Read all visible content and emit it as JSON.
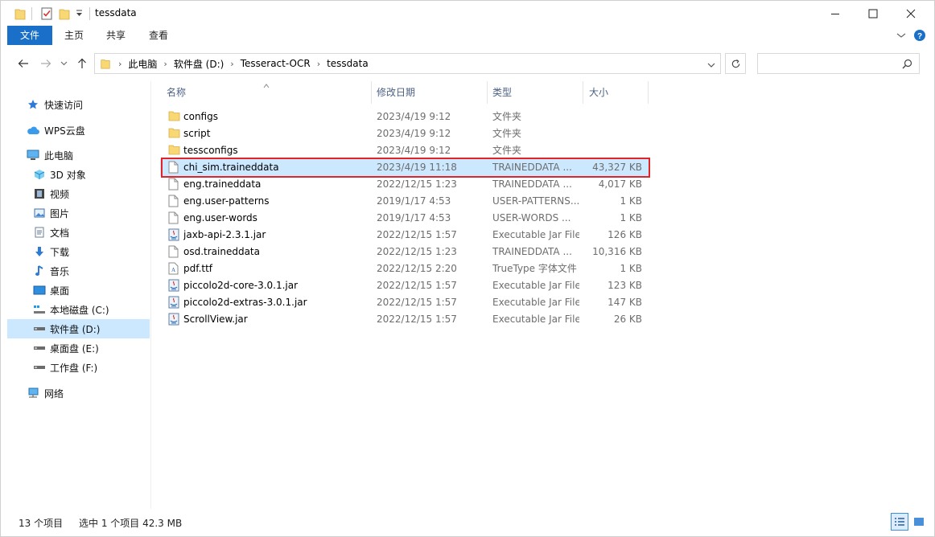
{
  "window": {
    "title": "tessdata",
    "buttons": {
      "minimize": "—",
      "maximize": "☐",
      "close": "✕"
    }
  },
  "ribbon": {
    "tabs": [
      {
        "label": "文件"
      },
      {
        "label": "主页"
      },
      {
        "label": "共享"
      },
      {
        "label": "查看"
      }
    ]
  },
  "address": {
    "crumbs": [
      "此电脑",
      "软件盘 (D:)",
      "Tesseract-OCR",
      "tessdata"
    ],
    "search_placeholder": ""
  },
  "sidebar": {
    "items": [
      {
        "label": "快速访问",
        "icon": "star-icon"
      },
      {
        "label": "WPS云盘",
        "icon": "cloud-icon"
      },
      {
        "label": "此电脑",
        "icon": "computer-icon"
      },
      {
        "label": "3D 对象",
        "icon": "cube-icon"
      },
      {
        "label": "视频",
        "icon": "video-icon"
      },
      {
        "label": "图片",
        "icon": "picture-icon"
      },
      {
        "label": "文档",
        "icon": "document-icon"
      },
      {
        "label": "下载",
        "icon": "download-icon"
      },
      {
        "label": "音乐",
        "icon": "music-icon"
      },
      {
        "label": "桌面",
        "icon": "desktop-icon"
      },
      {
        "label": "本地磁盘 (C:)",
        "icon": "system-drive-icon"
      },
      {
        "label": "软件盘 (D:)",
        "icon": "drive-icon",
        "selected": true
      },
      {
        "label": "桌面盘 (E:)",
        "icon": "drive-icon"
      },
      {
        "label": "工作盘 (F:)",
        "icon": "drive-icon"
      },
      {
        "label": "网络",
        "icon": "network-icon"
      }
    ]
  },
  "columns": {
    "name": "名称",
    "date": "修改日期",
    "type": "类型",
    "size": "大小"
  },
  "files": [
    {
      "name": "configs",
      "date": "2023/4/19 9:12",
      "type": "文件夹",
      "size": "",
      "icon": "folder-icon"
    },
    {
      "name": "script",
      "date": "2023/4/19 9:12",
      "type": "文件夹",
      "size": "",
      "icon": "folder-icon"
    },
    {
      "name": "tessconfigs",
      "date": "2023/4/19 9:12",
      "type": "文件夹",
      "size": "",
      "icon": "folder-icon"
    },
    {
      "name": "chi_sim.traineddata",
      "date": "2023/4/19 11:18",
      "type": "TRAINEDDATA ...",
      "size": "43,327 KB",
      "icon": "file-icon",
      "selected": true
    },
    {
      "name": "eng.traineddata",
      "date": "2022/12/15 1:23",
      "type": "TRAINEDDATA ...",
      "size": "4,017 KB",
      "icon": "file-icon"
    },
    {
      "name": "eng.user-patterns",
      "date": "2019/1/17 4:53",
      "type": "USER-PATTERNS...",
      "size": "1 KB",
      "icon": "file-icon"
    },
    {
      "name": "eng.user-words",
      "date": "2019/1/17 4:53",
      "type": "USER-WORDS ...",
      "size": "1 KB",
      "icon": "file-icon"
    },
    {
      "name": "jaxb-api-2.3.1.jar",
      "date": "2022/12/15 1:57",
      "type": "Executable Jar File",
      "size": "126 KB",
      "icon": "jar-icon"
    },
    {
      "name": "osd.traineddata",
      "date": "2022/12/15 1:23",
      "type": "TRAINEDDATA ...",
      "size": "10,316 KB",
      "icon": "file-icon"
    },
    {
      "name": "pdf.ttf",
      "date": "2022/12/15 2:20",
      "type": "TrueType 字体文件",
      "size": "1 KB",
      "icon": "font-icon"
    },
    {
      "name": "piccolo2d-core-3.0.1.jar",
      "date": "2022/12/15 1:57",
      "type": "Executable Jar File",
      "size": "123 KB",
      "icon": "jar-icon"
    },
    {
      "name": "piccolo2d-extras-3.0.1.jar",
      "date": "2022/12/15 1:57",
      "type": "Executable Jar File",
      "size": "147 KB",
      "icon": "jar-icon"
    },
    {
      "name": "ScrollView.jar",
      "date": "2022/12/15 1:57",
      "type": "Executable Jar File",
      "size": "26 KB",
      "icon": "jar-icon"
    }
  ],
  "status": {
    "count": "13 个项目",
    "selection": "选中 1 个项目  42.3 MB"
  },
  "colors": {
    "accent": "#1a6fc9",
    "selection": "#cce8ff",
    "annotation": "#e0242a",
    "folder": "#f8d775"
  }
}
